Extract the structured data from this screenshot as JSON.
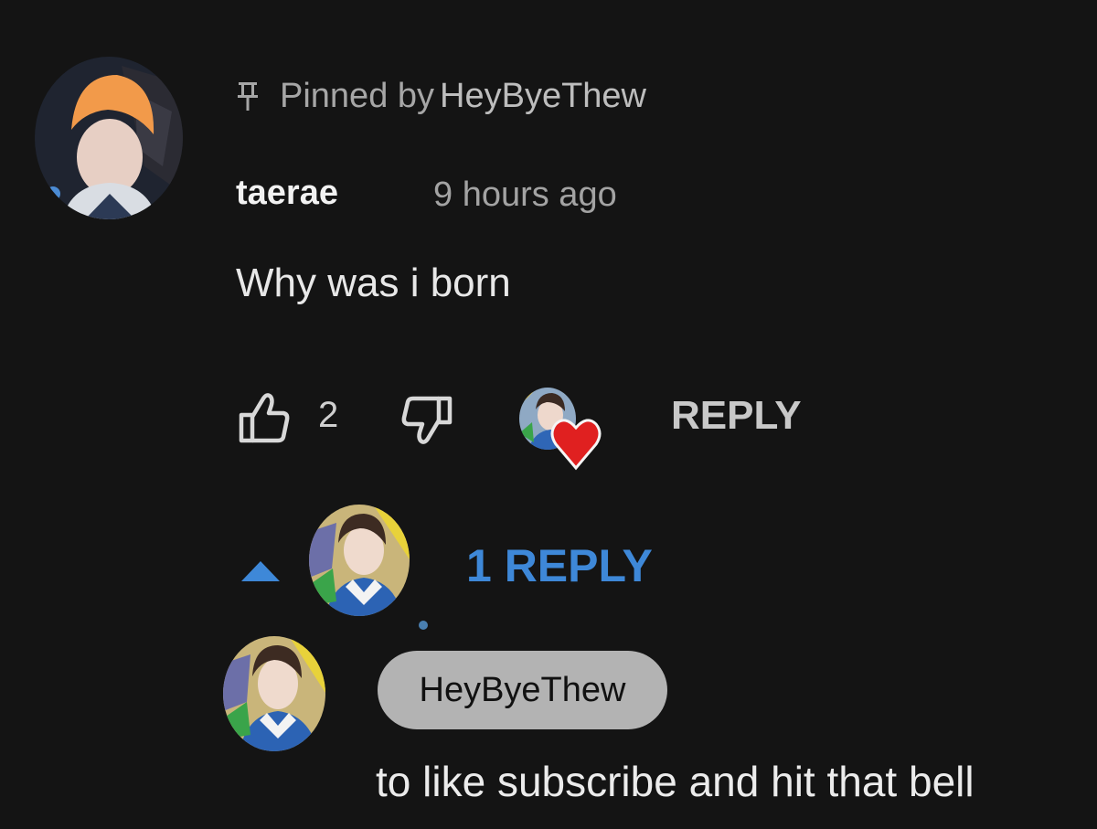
{
  "comment": {
    "pinned_label": "Pinned by",
    "pinned_by": "HeyByeThew",
    "author": "taerae",
    "timestamp": "9 hours ago",
    "text": "Why was i born",
    "like_count": "2",
    "reply_button": "REPLY",
    "author_avatar_icon": "user-avatar",
    "creator_heart_icon": "creator-heart-icon"
  },
  "replies_toggle": {
    "label": "1 REPLY",
    "icon": "chevron-up-icon"
  },
  "reply": {
    "mention": "HeyByeThew",
    "text": "to like subscribe and hit that bell"
  },
  "colors": {
    "background": "#141414",
    "link_blue": "#3e88d8",
    "heart_red": "#e02020",
    "pill_gray": "#b3b3b3"
  }
}
